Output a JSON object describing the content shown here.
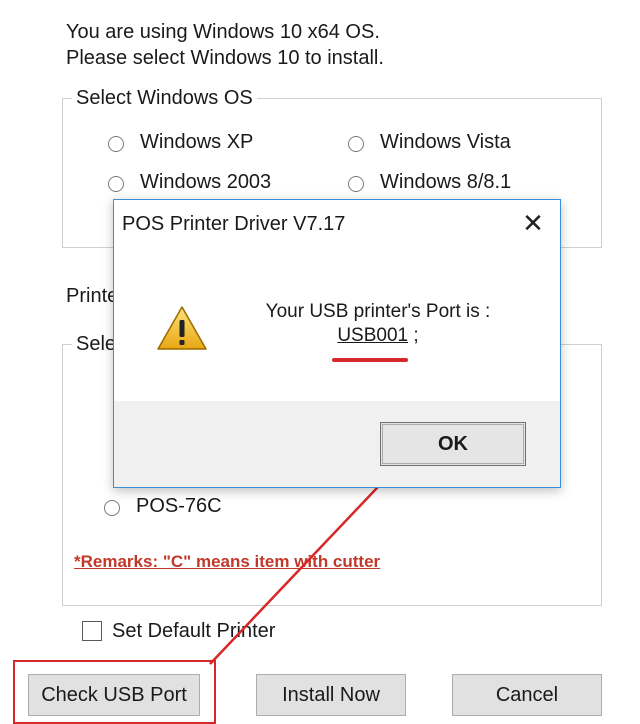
{
  "installer": {
    "info_line1": "You are using Windows 10 x64 OS.",
    "info_line2": "Please select Windows 10 to install.",
    "os_group": {
      "legend": "Select Windows OS",
      "options": [
        "Windows XP",
        "Windows Vista",
        "Windows 2003",
        "Windows 8/8.1"
      ]
    },
    "printer_label": "Printe",
    "printer_group": {
      "legend": "Sele",
      "options": [
        "POS-76C"
      ]
    },
    "remarks": "*Remarks: \"C\" means item with cutter",
    "set_default_label": "Set Default Printer",
    "buttons": {
      "check_usb": "Check USB Port",
      "install": "Install Now",
      "cancel": "Cancel"
    }
  },
  "dialog": {
    "title": "POS Printer Driver V7.17",
    "close_glyph": "✕",
    "message_line1": "Your USB printer's Port is :",
    "port": "USB001",
    "port_suffix": " ;",
    "ok_label": "OK",
    "icon": "warning-icon"
  },
  "annotation": {
    "color": "#d62828"
  }
}
